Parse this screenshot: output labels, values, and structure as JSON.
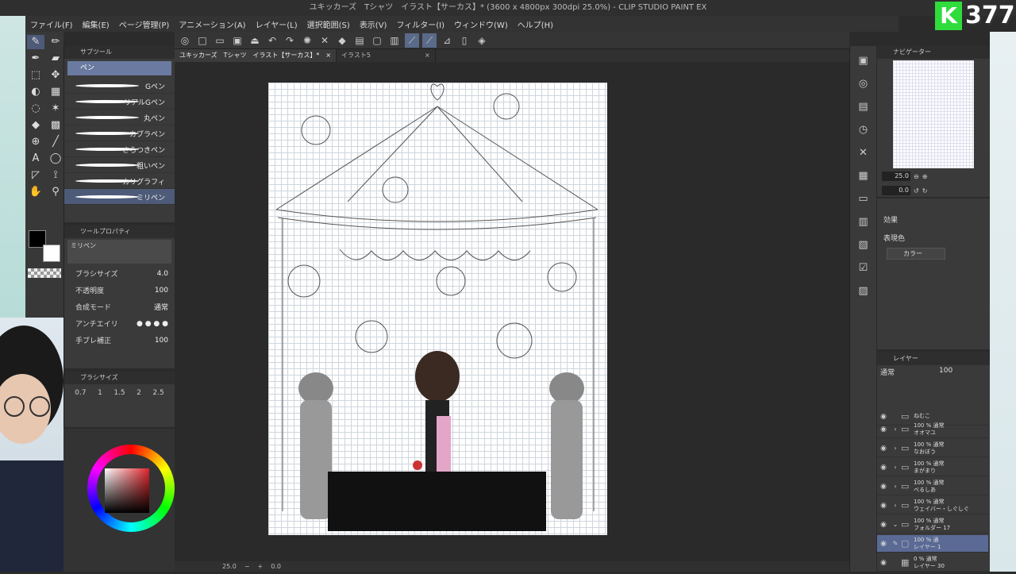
{
  "window": {
    "title": "ユキッカーズ　Tシャツ　イラスト【サーカス】* (3600 x 4800px 300dpi 25.0%)  - CLIP STUDIO PAINT EX"
  },
  "menu": [
    "ファイル(F)",
    "編集(E)",
    "ページ管理(P)",
    "アニメーション(A)",
    "レイヤー(L)",
    "選択範囲(S)",
    "表示(V)",
    "フィルター(I)",
    "ウィンドウ(W)",
    "ヘルプ(H)"
  ],
  "badge": {
    "letter": "K",
    "number": "377"
  },
  "subtool": {
    "title": "サブツール",
    "tab": "ペン",
    "brushes": [
      "Gペン",
      "リアルGペン",
      "丸ペン",
      "カブラペン",
      "さらつきペン",
      "粗いペン",
      "カリグラフィ",
      "ミリペン"
    ],
    "selected_index": 7
  },
  "toolprop": {
    "title": "ツールプロパティ",
    "preset": "ミリペン",
    "rows": [
      {
        "label": "ブラシサイズ",
        "value": "4.0"
      },
      {
        "label": "不透明度",
        "value": "100"
      },
      {
        "label": "合成モード",
        "value": "通常"
      },
      {
        "label": "アンチエイリ",
        "value": ""
      },
      {
        "label": "手ブレ補正",
        "value": "100"
      }
    ]
  },
  "brushsize": {
    "title": "ブラシサイズ",
    "values": [
      "0.7",
      "1",
      "1.5",
      "2",
      "2.5"
    ]
  },
  "doc_tabs": [
    {
      "label": "ユキッカーズ　Tシャツ　イラスト【サーカス】*",
      "active": true
    },
    {
      "label": "イラスト5",
      "active": false
    }
  ],
  "status": {
    "zoom": "25.0",
    "angle": "0.0"
  },
  "navigator": {
    "title": "ナビゲーター",
    "zoom": "25.0",
    "angle": "0.0"
  },
  "effects": {
    "title": "効果",
    "color_label": "表現色",
    "color_value": "カラー"
  },
  "layers": {
    "title": "レイヤー",
    "blend": "通常",
    "opacity": "100",
    "items": [
      {
        "opacity": "",
        "mode": "",
        "name": "ねむこ",
        "type": "folder"
      },
      {
        "opacity": "100 %",
        "mode": "通常",
        "name": "オオマユ",
        "type": "folder"
      },
      {
        "opacity": "100 %",
        "mode": "通常",
        "name": "なおぼう",
        "type": "folder"
      },
      {
        "opacity": "100 %",
        "mode": "通常",
        "name": "まがまり",
        "type": "folder"
      },
      {
        "opacity": "100 %",
        "mode": "通常",
        "name": "べるしあ",
        "type": "folder"
      },
      {
        "opacity": "100 %",
        "mode": "通常",
        "name": "ウェイバー・しぐしぐ",
        "type": "folder"
      },
      {
        "opacity": "100 %",
        "mode": "通常",
        "name": "フォルダー 17",
        "type": "folder"
      },
      {
        "opacity": "100 %",
        "mode": "通",
        "name": "レイヤー 1",
        "type": "layer",
        "selected": true
      },
      {
        "opacity": "0 %",
        "mode": "通常",
        "name": "レイヤー 30",
        "type": "layer"
      }
    ]
  },
  "colors": {
    "accent": "#5a6a95",
    "panel": "#3a3a3a",
    "bg": "#2b2b2b"
  }
}
